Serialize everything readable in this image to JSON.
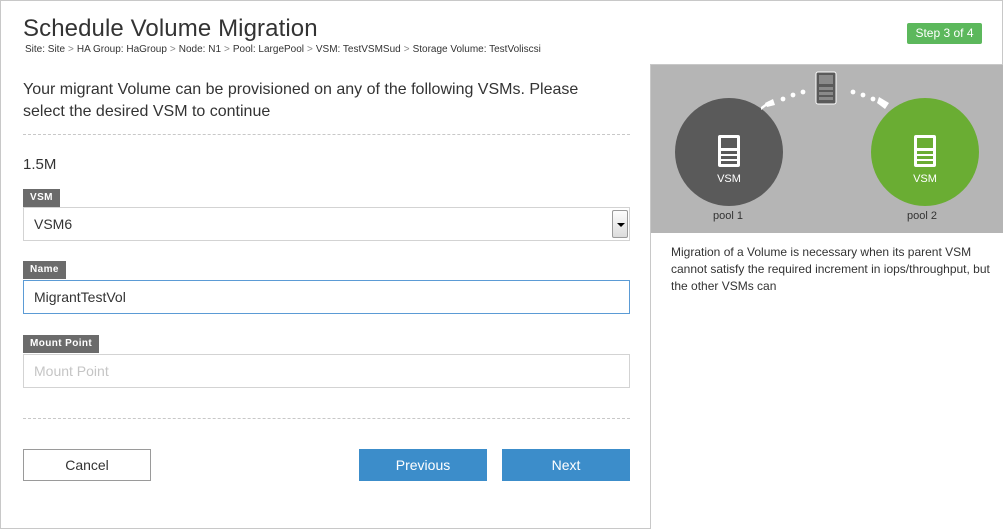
{
  "header": {
    "title": "Schedule Volume Migration",
    "step": "Step 3 of 4",
    "breadcrumb": [
      "Site: Site",
      "HA Group: HaGroup",
      "Node: N1",
      "Pool: LargePool",
      "VSM: TestVSMSud",
      "Storage Volume: TestVoliscsi"
    ],
    "breadcrumb_separator": ">"
  },
  "main": {
    "intro": "Your migrant Volume can be provisioned on any of the following VSMs. Please select the desired VSM to continue",
    "size": "1.5M",
    "fields": {
      "vsm": {
        "label": "VSM",
        "value": "VSM6"
      },
      "name": {
        "label": "Name",
        "value": "MigrantTestVol"
      },
      "mount_point": {
        "label": "Mount Point",
        "value": "",
        "placeholder": "Mount Point"
      }
    }
  },
  "buttons": {
    "cancel": "Cancel",
    "previous": "Previous",
    "next": "Next"
  },
  "panel": {
    "source": {
      "circle_label": "VSM",
      "pool_label": "pool 1",
      "color": "#5a5a5a"
    },
    "destination": {
      "circle_label": "VSM",
      "pool_label": "pool 2",
      "color": "#6aad33"
    },
    "info": "Migration of a Volume is necessary when its parent VSM cannot satisfy the required increment in iops/throughput, but the other VSMs can"
  },
  "colors": {
    "step_badge": "#5cb85c",
    "primary_button": "#3c8dca",
    "field_tag": "#6b6b6b",
    "panel_bg": "#b5b5b5"
  }
}
